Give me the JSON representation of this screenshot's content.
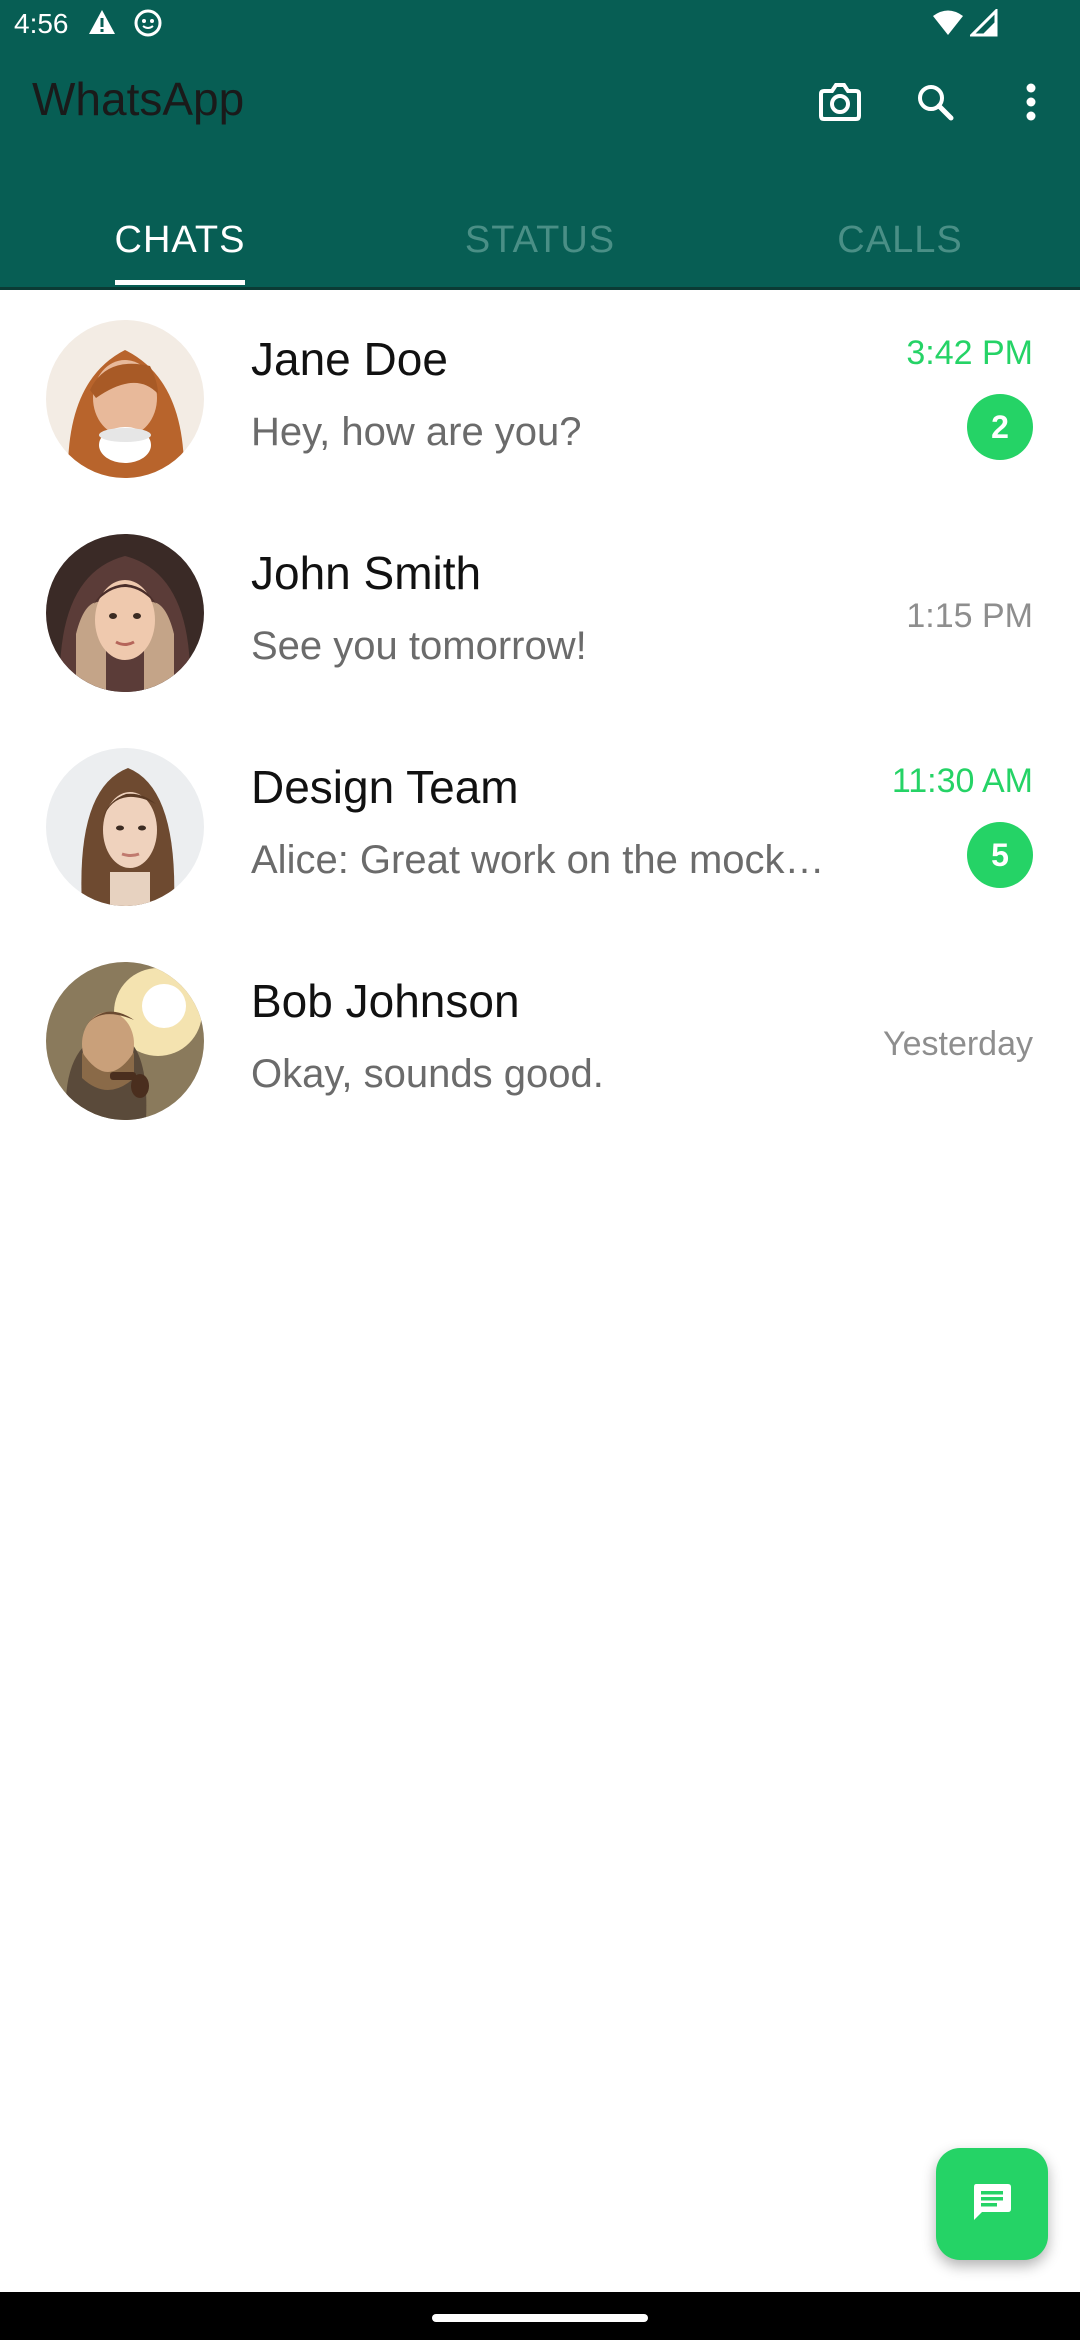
{
  "status_bar": {
    "time": "4:56",
    "icons": [
      "alert-icon",
      "notification-icon",
      "wifi-icon",
      "signal-icon"
    ]
  },
  "app_bar": {
    "title": "WhatsApp",
    "actions": [
      "camera-icon",
      "search-icon",
      "more-vert-icon"
    ]
  },
  "tabs": [
    {
      "label": "CHATS",
      "active": true
    },
    {
      "label": "STATUS",
      "active": false
    },
    {
      "label": "CALLS",
      "active": false
    }
  ],
  "chats": [
    {
      "name": "Jane Doe",
      "message": "Hey, how are you?",
      "time": "3:42 PM",
      "unread": "2"
    },
    {
      "name": "John Smith",
      "message": "See you tomorrow!",
      "time": "1:15 PM",
      "unread": ""
    },
    {
      "name": "Design Team",
      "message": "Alice: Great work on the mockups!",
      "time": "11:30 AM",
      "unread": "5"
    },
    {
      "name": "Bob Johnson",
      "message": "Okay, sounds good.",
      "time": "Yesterday",
      "unread": ""
    }
  ],
  "fab": {
    "icon": "new-chat-icon"
  },
  "colors": {
    "primary": "#075E54",
    "accent": "#25D366",
    "unread_time": "#25D366",
    "read_time": "#8e8e8e"
  }
}
